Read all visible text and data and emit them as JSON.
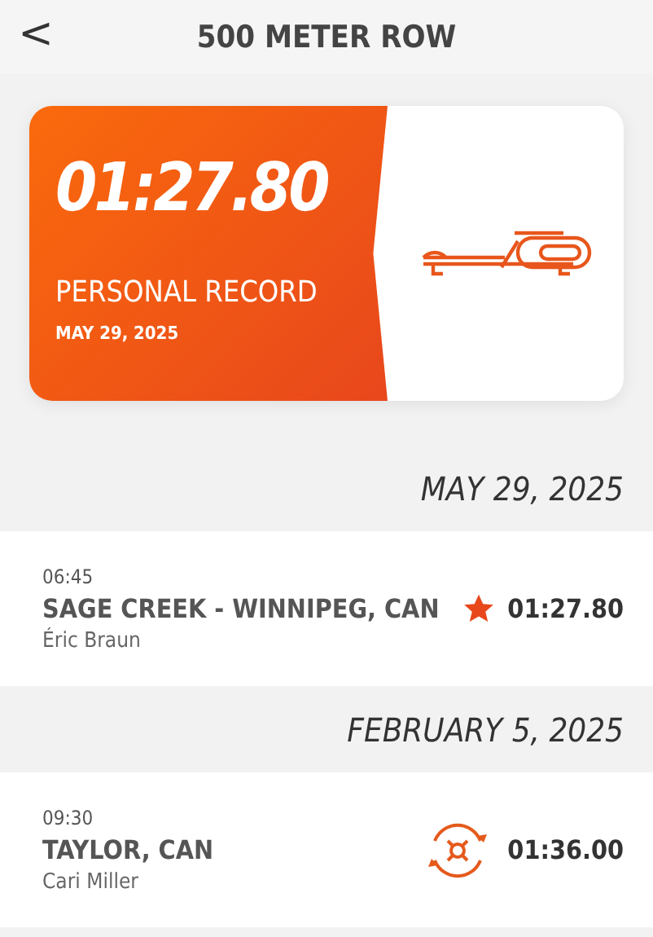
{
  "header": {
    "back": "<",
    "title": "500 METER ROW"
  },
  "record": {
    "time": "01:27.80",
    "label": "PERSONAL RECORD",
    "date": "MAY 29, 2025"
  },
  "sessions": [
    {
      "date": "MAY 29, 2025",
      "time": "06:45",
      "location": "SAGE CREEK - WINNIPEG, CAN",
      "coach": "Éric Braun",
      "kind": "star",
      "result": "01:27.80"
    },
    {
      "date": "FEBRUARY 5, 2025",
      "time": "09:30",
      "location": "TAYLOR, CAN",
      "coach": "Cari Miller",
      "kind": "orbit",
      "result": "01:36.00"
    }
  ]
}
